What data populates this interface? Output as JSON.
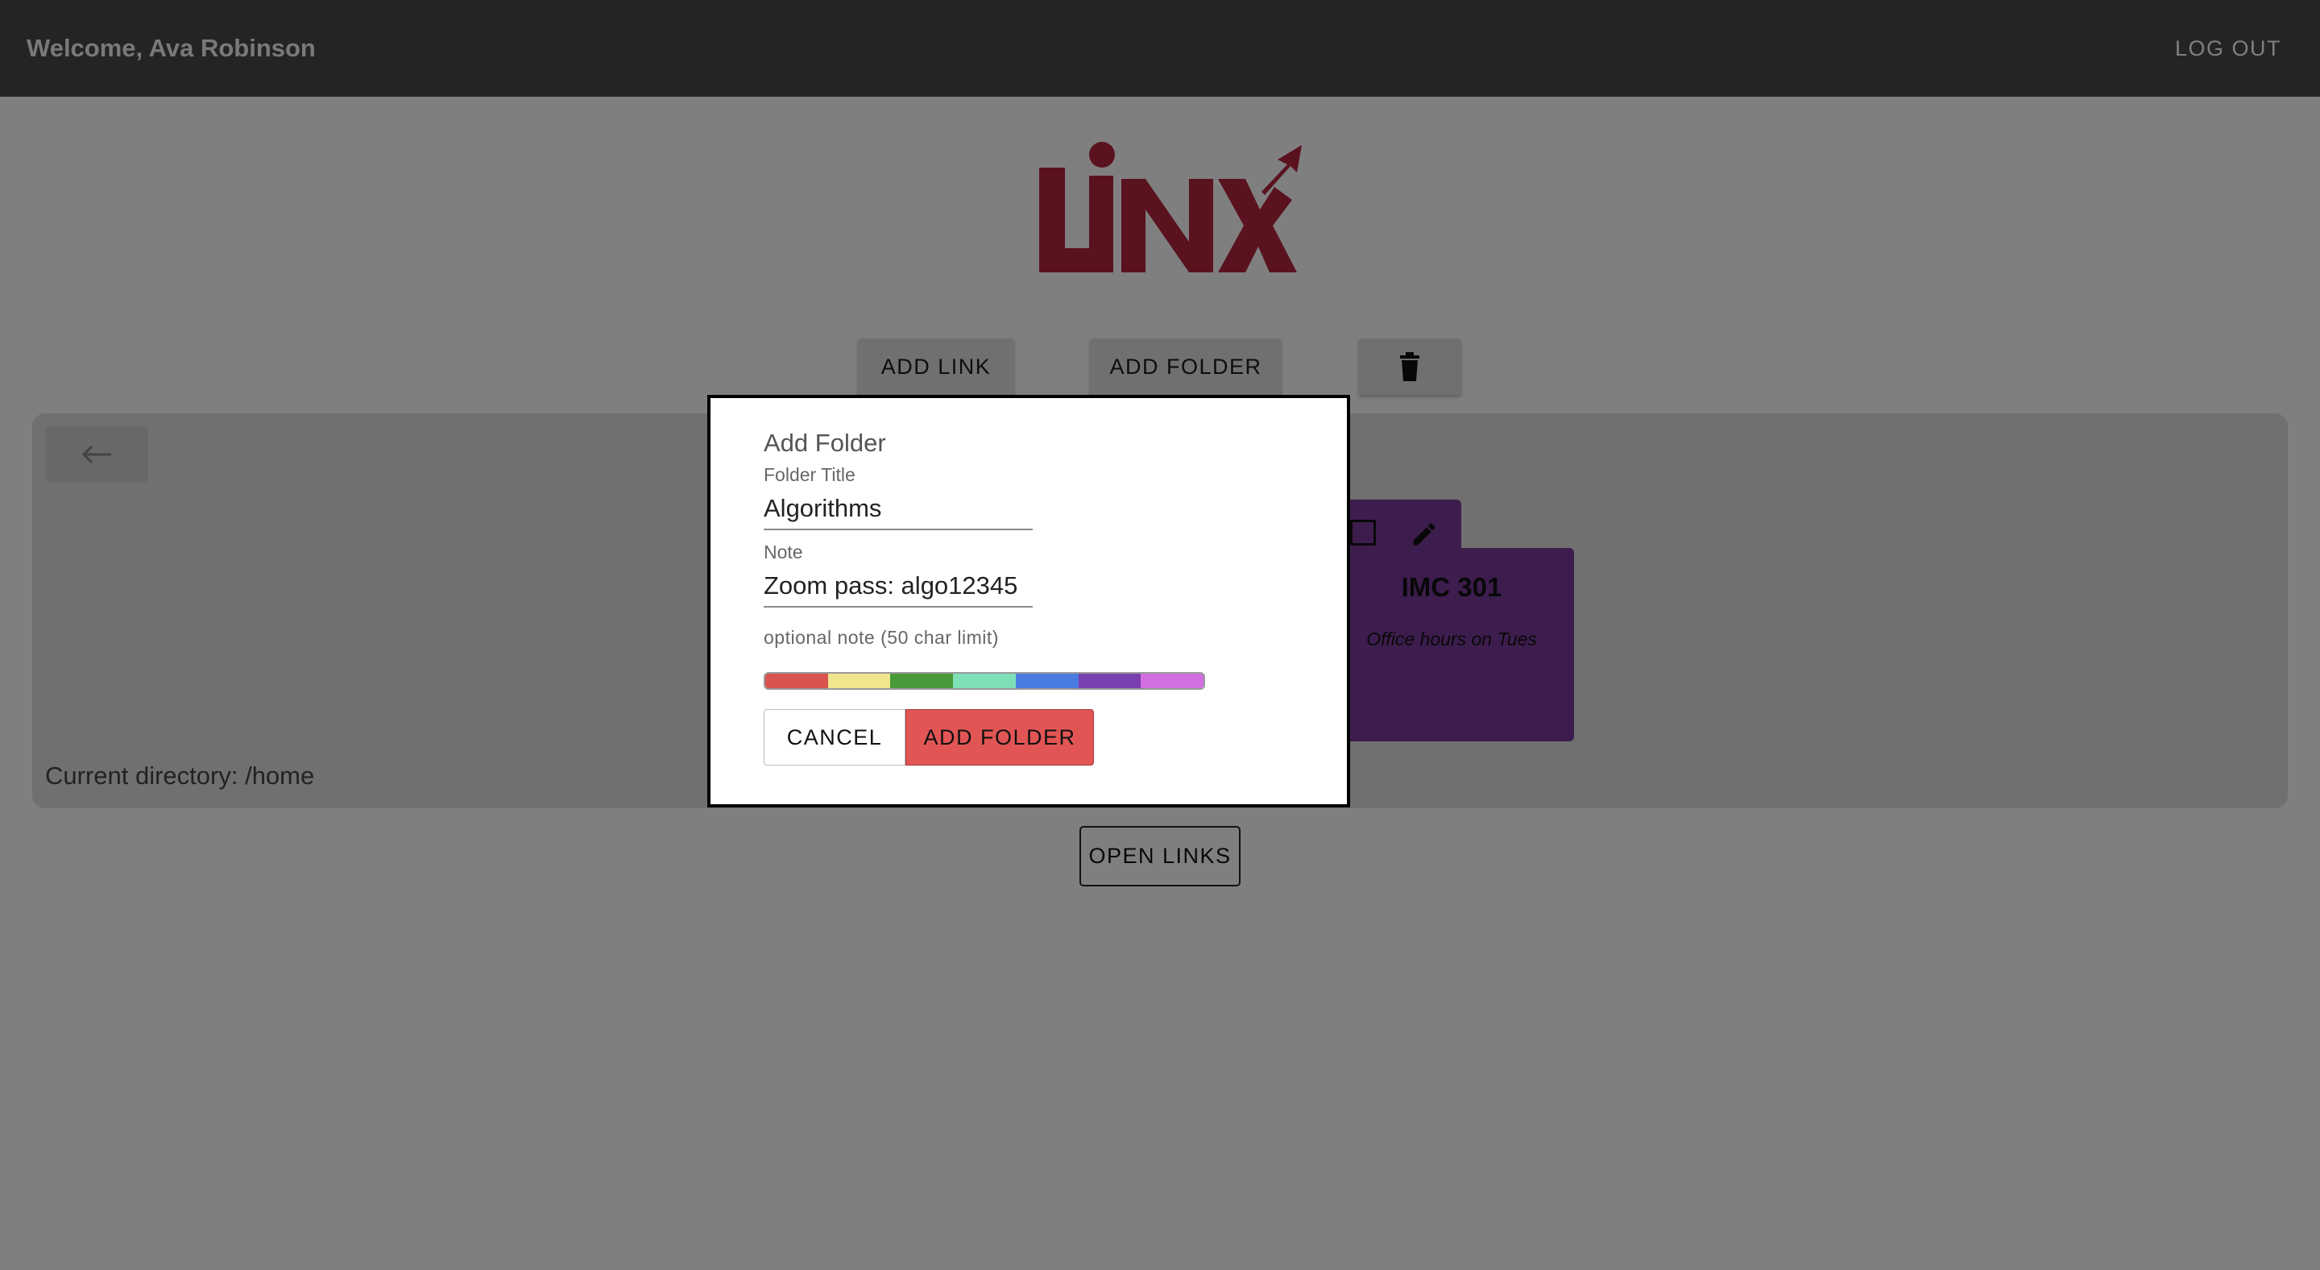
{
  "header": {
    "welcome": "Welcome, Ava Robinson",
    "logout_label": "LOG OUT"
  },
  "toolbar": {
    "add_link_label": "ADD LINK",
    "add_folder_label": "ADD FOLDER",
    "delete_icon": "trash-icon"
  },
  "panel": {
    "back_icon": "arrow-left-icon",
    "current_directory": "Current directory: /home",
    "folders": [
      {
        "title": "IMC 301",
        "note": "Office hours on Tues",
        "color": "#7a3b9a"
      }
    ]
  },
  "open_links_label": "OPEN LINKS",
  "dialog": {
    "title": "Add Folder",
    "folder_title_label": "Folder Title",
    "folder_title_value": "Algorithms",
    "note_label": "Note",
    "note_value": "Zoom pass: algo12345",
    "note_helper": "optional note (50 char limit)",
    "colors": [
      "#d9534f",
      "#f0e68c",
      "#4a9a3a",
      "#7fe0b8",
      "#4a7be0",
      "#7a3fb0",
      "#d36ee0"
    ],
    "cancel_label": "CANCEL",
    "submit_label": "ADD FOLDER"
  }
}
